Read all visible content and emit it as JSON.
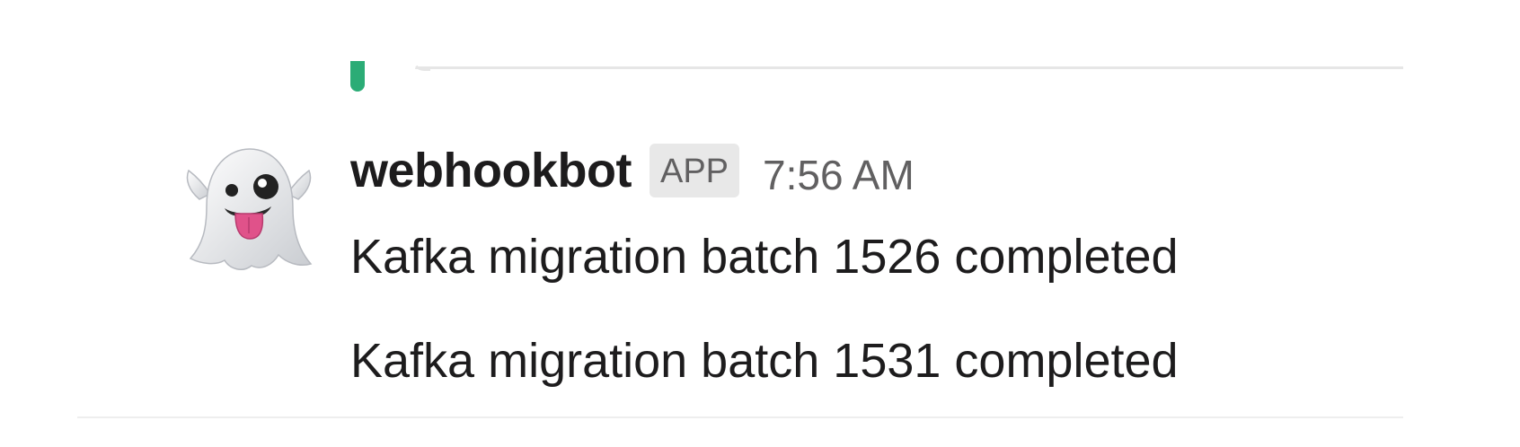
{
  "message": {
    "username": "webhookbot",
    "badge": "APP",
    "timestamp": "7:56 AM",
    "avatar_icon": "ghost-icon",
    "lines": [
      "Kafka migration batch 1526 completed",
      "Kafka migration batch 1531 completed"
    ]
  },
  "colors": {
    "text": "#1d1c1d",
    "muted": "#616061",
    "badge_bg": "#e8e8e8",
    "attachment_bar": "#2bac76"
  }
}
